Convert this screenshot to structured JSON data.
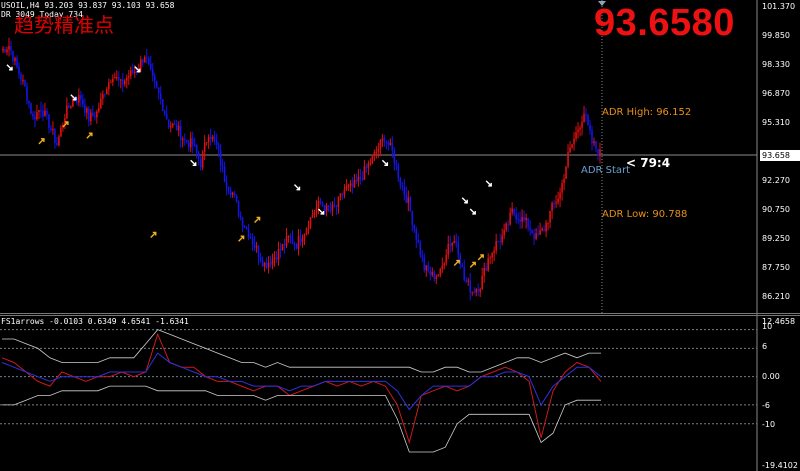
{
  "header": {
    "symbol_line": "USOIL,H4  93.203 93.837 93.103 93.658",
    "adr_line": "DR 3049  Today 734",
    "brand_text": "趋势精准点",
    "big_price": "93.6580"
  },
  "annotations": {
    "adr_high": "ADR High: 96.152",
    "adr_low": "ADR Low: 90.788",
    "adr_start": "ADR Start",
    "ratio": "< 79:4"
  },
  "price_axis": [
    "101.370",
    "99.850",
    "98.330",
    "96.870",
    "95.310",
    "92.270",
    "90.750",
    "89.250",
    "87.750",
    "86.210"
  ],
  "price_axis_current": "93.658",
  "indicator": {
    "title_line": "FS1arrows -0.0103 0.6349 4.6541 -1.6341"
  },
  "indicator_axis": [
    "12.4658",
    "10",
    "6",
    "0.00",
    "-6",
    "-10",
    "-19.4102"
  ],
  "colors": {
    "bull": "#e01010",
    "bear": "#1515e6",
    "arrow_down": "#ffffff",
    "arrow_up": "#f0b020",
    "adr_text": "#e8901a",
    "big_price": "#ee1111",
    "ind_line_a": "#cc1a1a",
    "ind_line_b": "#3030dd",
    "ind_band": "#cfcfcf"
  },
  "chart_data": {
    "type": "candlestick",
    "symbol": "USOIL",
    "timeframe": "H4",
    "price_range": [
      85.9,
      101.6
    ],
    "close_trend": [
      99.2,
      99.5,
      98.3,
      97.2,
      95.6,
      96.2,
      95.3,
      94.2,
      95.8,
      96.6,
      96.7,
      95.6,
      95.9,
      97.1,
      98.0,
      97.4,
      97.9,
      98.2,
      99.0,
      97.6,
      96.6,
      95.3,
      95.1,
      94.4,
      94.2,
      93.2,
      94.9,
      94.1,
      92.4,
      91.6,
      90.3,
      89.5,
      88.6,
      87.8,
      88.1,
      88.6,
      89.2,
      88.9,
      89.6,
      90.5,
      91.1,
      90.6,
      90.9,
      91.8,
      91.9,
      92.4,
      93.1,
      93.8,
      94.6,
      93.8,
      92.2,
      91.1,
      89.3,
      87.6,
      87.2,
      87.3,
      88.9,
      89.1,
      87.0,
      86.4,
      86.7,
      88.1,
      88.9,
      89.4,
      90.6,
      90.3,
      89.9,
      89.2,
      89.7,
      90.8,
      91.6,
      93.6,
      94.8,
      95.9,
      94.3,
      93.7
    ],
    "signals_down": [
      [
        1,
        98.3
      ],
      [
        9,
        96.7
      ],
      [
        17,
        98.2
      ],
      [
        24,
        93.2
      ],
      [
        37,
        91.9
      ],
      [
        40,
        90.6
      ],
      [
        48,
        93.2
      ],
      [
        58,
        91.2
      ],
      [
        59,
        90.6
      ],
      [
        61,
        92.1
      ]
    ],
    "signals_up": [
      [
        5,
        94.4
      ],
      [
        8,
        95.3
      ],
      [
        11,
        94.7
      ],
      [
        19,
        89.4
      ],
      [
        30,
        89.2
      ],
      [
        32,
        90.2
      ],
      [
        57,
        87.9
      ],
      [
        59,
        87.8
      ],
      [
        60,
        88.2
      ]
    ],
    "indicator": {
      "axis_range": [
        -19.4102,
        12.4658
      ],
      "levels": [
        10,
        6,
        0,
        -6,
        -10
      ],
      "series": [
        {
          "values": [
            4,
            3,
            1,
            -1,
            -2,
            1,
            0,
            -1,
            0,
            0,
            1,
            0,
            1,
            9,
            3,
            2,
            2,
            0,
            -1,
            -1,
            -2,
            -3,
            -2,
            -2,
            -4,
            -3,
            -2,
            -1,
            -2,
            -1,
            -2,
            -1,
            -2,
            -6,
            -14,
            -4,
            -3,
            -2,
            -3,
            -2,
            0,
            1,
            2,
            1,
            -1,
            -13,
            -3,
            1,
            3,
            2,
            -1
          ]
        },
        {
          "values": [
            3,
            2,
            1,
            0,
            -1,
            0,
            0,
            0,
            0,
            1,
            1,
            1,
            1,
            5,
            3,
            2,
            1,
            0,
            0,
            -1,
            -1,
            -2,
            -2,
            -2,
            -3,
            -2,
            -2,
            -1,
            -1,
            -1,
            -1,
            -1,
            -1,
            -3,
            -7,
            -4,
            -2,
            -2,
            -2,
            -2,
            0,
            0,
            1,
            1,
            0,
            -6,
            -2,
            0,
            2,
            2,
            0
          ]
        },
        {
          "values": [
            8,
            8,
            7,
            6,
            4,
            3,
            3,
            3,
            3,
            4,
            4,
            4,
            7,
            10,
            9,
            8,
            7,
            6,
            5,
            4,
            3,
            3,
            2,
            3,
            2,
            2,
            2,
            2,
            2,
            2,
            2,
            2,
            2,
            2,
            2,
            1,
            1,
            2,
            2,
            1,
            1,
            2,
            3,
            4,
            4,
            3,
            4,
            5,
            4,
            5,
            5
          ]
        },
        {
          "values": [
            -6,
            -6,
            -5,
            -4,
            -4,
            -3,
            -3,
            -3,
            -3,
            -2,
            -2,
            -2,
            -2,
            -3,
            -3,
            -3,
            -3,
            -3,
            -4,
            -4,
            -4,
            -4,
            -5,
            -4,
            -4,
            -4,
            -4,
            -4,
            -4,
            -4,
            -4,
            -4,
            -4,
            -9,
            -16,
            -16,
            -16,
            -15,
            -10,
            -8,
            -8,
            -8,
            -8,
            -8,
            -8,
            -14,
            -12,
            -6,
            -5,
            -5,
            -5
          ]
        }
      ]
    }
  }
}
